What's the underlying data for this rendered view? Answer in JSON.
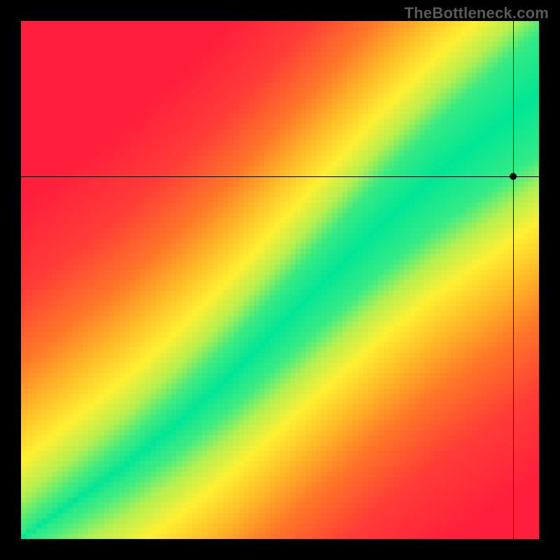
{
  "watermark": "TheBottleneck.com",
  "chart_data": {
    "type": "heatmap",
    "title": "",
    "xlabel": "",
    "ylabel": "",
    "xlim": [
      0,
      100
    ],
    "ylim": [
      0,
      100
    ],
    "grid_resolution": 100,
    "colormap": {
      "description": "red→orange→yellow→green→yellow→orange→red based on distance from an optimal diagonal band",
      "stops": [
        {
          "d": 0.0,
          "rgb": [
            0,
            230,
            150
          ]
        },
        {
          "d": 0.1,
          "rgb": [
            60,
            235,
            130
          ]
        },
        {
          "d": 0.18,
          "rgb": [
            180,
            240,
            80
          ]
        },
        {
          "d": 0.28,
          "rgb": [
            255,
            240,
            50
          ]
        },
        {
          "d": 0.4,
          "rgb": [
            255,
            190,
            40
          ]
        },
        {
          "d": 0.55,
          "rgb": [
            255,
            120,
            40
          ]
        },
        {
          "d": 0.75,
          "rgb": [
            255,
            60,
            55
          ]
        },
        {
          "d": 1.0,
          "rgb": [
            255,
            30,
            60
          ]
        }
      ]
    },
    "optimal_band": {
      "description": "green band center expressed as y(x) for x in [0,100]; band_half_width grows with x",
      "control_points": [
        {
          "x": 0,
          "y": 0,
          "half_width": 1
        },
        {
          "x": 10,
          "y": 7,
          "half_width": 2
        },
        {
          "x": 20,
          "y": 14,
          "half_width": 3
        },
        {
          "x": 30,
          "y": 22,
          "half_width": 4
        },
        {
          "x": 40,
          "y": 31,
          "half_width": 5
        },
        {
          "x": 50,
          "y": 41,
          "half_width": 6
        },
        {
          "x": 60,
          "y": 51,
          "half_width": 7
        },
        {
          "x": 70,
          "y": 61,
          "half_width": 8
        },
        {
          "x": 80,
          "y": 70,
          "half_width": 9
        },
        {
          "x": 90,
          "y": 78,
          "half_width": 10
        },
        {
          "x": 100,
          "y": 86,
          "half_width": 11
        }
      ]
    },
    "crosshair": {
      "x": 95,
      "y": 70
    },
    "marker": {
      "x": 95,
      "y": 70
    }
  }
}
